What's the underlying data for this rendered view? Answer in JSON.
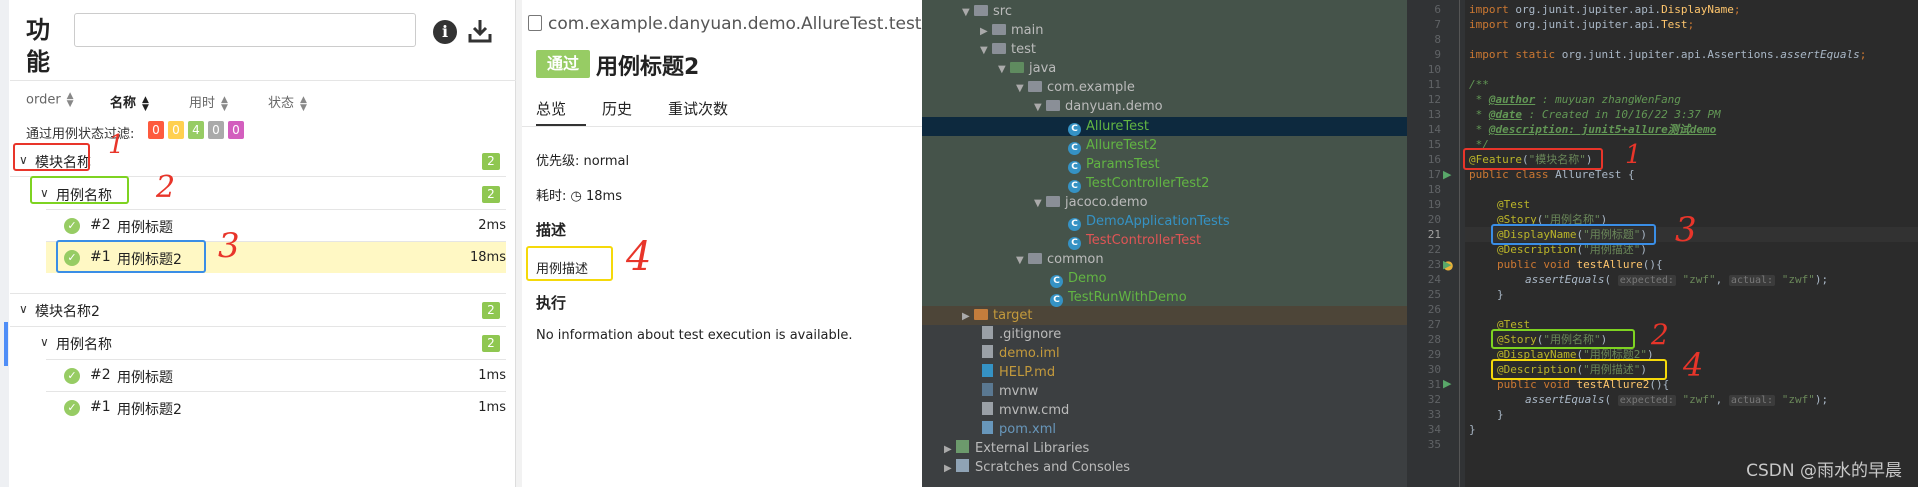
{
  "allure_left": {
    "title": "功能",
    "search_value": "",
    "sort_headers": [
      "order",
      "名称",
      "用时",
      "状态"
    ],
    "filter_label": "通过用例状态过滤:",
    "filter_badges": [
      {
        "value": "0",
        "color": "#fd5a3e"
      },
      {
        "value": "0",
        "color": "#ffd050"
      },
      {
        "value": "4",
        "color": "#97cc64"
      },
      {
        "value": "0",
        "color": "#aaaaaa"
      },
      {
        "value": "0",
        "color": "#d35ebe"
      }
    ],
    "tree": {
      "group1_label": "模块名称",
      "group1_count": "2",
      "group1_sub_label": "用例名称",
      "group1_sub_count": "2",
      "group1_case1_order": "#2",
      "group1_case1_name": "用例标题",
      "group1_case1_time": "2ms",
      "group1_case2_order": "#1",
      "group1_case2_name": "用例标题2",
      "group1_case2_time": "18ms",
      "group2_label": "模块名称2",
      "group2_count": "2",
      "group2_sub_label": "用例名称",
      "group2_sub_count": "2",
      "group2_case1_order": "#2",
      "group2_case1_name": "用例标题",
      "group2_case1_time": "1ms",
      "group2_case2_order": "#1",
      "group2_case2_name": "用例标题2",
      "group2_case2_time": "1ms"
    }
  },
  "allure_right": {
    "test_path": "com.example.danyuan.demo.AllureTest.testAllu",
    "status_badge": "通过",
    "test_title": "用例标题2",
    "tabs": [
      "总览",
      "历史",
      "重试次数"
    ],
    "priority": "优先级: normal",
    "duration": "耗时: ◷ 18ms",
    "description_heading": "描述",
    "description_value": "用例描述",
    "execution_heading": "执行",
    "execution_text": "No information about test execution is available."
  },
  "annotations": [
    "1",
    "2",
    "3",
    "4"
  ],
  "ide_project": {
    "items": [
      "src",
      "main",
      "test",
      "java",
      "com.example",
      "danyuan.demo",
      "AllureTest",
      "AllureTest2",
      "ParamsTest",
      "TestControllerTest2",
      "jacoco.demo",
      "DemoApplicationTests",
      "TestControllerTest",
      "common",
      "Demo",
      "TestRunWithDemo",
      "target",
      ".gitignore",
      "demo.iml",
      "HELP.md",
      "mvnw",
      "mvnw.cmd",
      "pom.xml",
      "External Libraries",
      "Scratches and Consoles"
    ]
  },
  "ide_editor": {
    "line_numbers": [
      "6",
      "7",
      "8",
      "9",
      "10",
      "11",
      "12",
      "13",
      "14",
      "15",
      "16",
      "17",
      "18",
      "19",
      "20",
      "21",
      "22",
      "23",
      "24",
      "25",
      "26",
      "27",
      "28",
      "29",
      "30",
      "31",
      "32",
      "33",
      "34",
      "35"
    ],
    "l6": {
      "a": "import ",
      "b": "org.junit.jupiter.api.",
      "c": "DisplayName",
      "d": ";"
    },
    "l7": {
      "a": "import ",
      "b": "org.junit.jupiter.api.",
      "c": "Test",
      "d": ";"
    },
    "l9": {
      "a": "import static ",
      "b": "org.junit.jupiter.api.Assertions.",
      "c": "assertEquals",
      "d": ";"
    },
    "l11": "/**",
    "l12": {
      "a": " * ",
      "b": "@author",
      "c": " : muyuan zhangWenFang"
    },
    "l13": {
      "a": " * ",
      "b": "@date",
      "c": " : Created in 10/16/22 3:37 PM"
    },
    "l14": {
      "a": " * ",
      "b": "@description",
      "c": ": junit5+allure测试demo"
    },
    "l15": " */",
    "l16": {
      "a": "@Feature",
      "b": "(",
      "c": "\"模块名称\"",
      "d": ")"
    },
    "l17": {
      "a": "public class ",
      "b": "AllureTest {"
    },
    "l19": "@Test",
    "l20": {
      "a": "@Story",
      "b": "(",
      "c": "\"用例名称\"",
      "d": ")"
    },
    "l21": {
      "a": "@DisplayName",
      "b": "(",
      "c": "\"用例标题\"",
      "d": ")"
    },
    "l22": {
      "a": "@Description",
      "b": "(",
      "c": "\"用例描述\"",
      "d": ")"
    },
    "l23": {
      "a": "public void ",
      "b": "testAllure",
      "c": "(){"
    },
    "l24": {
      "a": "assertEquals",
      "b": "( ",
      "h1": "expected:",
      "s1": " \"zwf\"",
      "c": ", ",
      "h2": "actual:",
      "s2": " \"zwf\"",
      "d": ");"
    },
    "l25": "}",
    "l27": "@Test",
    "l28": {
      "a": "@Story",
      "b": "(",
      "c": "\"用例名称\"",
      "d": ")"
    },
    "l29": {
      "a": "@DisplayName",
      "b": "(",
      "c": "\"用例标题2\"",
      "d": ")"
    },
    "l30": {
      "a": "@Description",
      "b": "(",
      "c": "\"用例描述\"",
      "d": ")"
    },
    "l31": {
      "a": "public void ",
      "b": "testAllure2",
      "c": "(){"
    },
    "l32": {
      "a": "assertEquals",
      "b": "( ",
      "h1": "expected:",
      "s1": " \"zwf\"",
      "c": ", ",
      "h2": "actual:",
      "s2": " \"zwf\"",
      "d": ");"
    },
    "l33": "}",
    "l34": "}",
    "watermark": "CSDN @雨水的早晨"
  },
  "colors": {
    "passed": "#97cc64",
    "annotation_red": "#e8352a",
    "annotation_green": "#7ed321",
    "annotation_blue": "#3a8ee6",
    "annotation_yellow": "#f5d90a",
    "ide_bg": "#2b2b2b",
    "ide_project_bg": "#3c3f41",
    "ide_selected": "#0d293e",
    "ide_row_green": "#4a5a45"
  }
}
